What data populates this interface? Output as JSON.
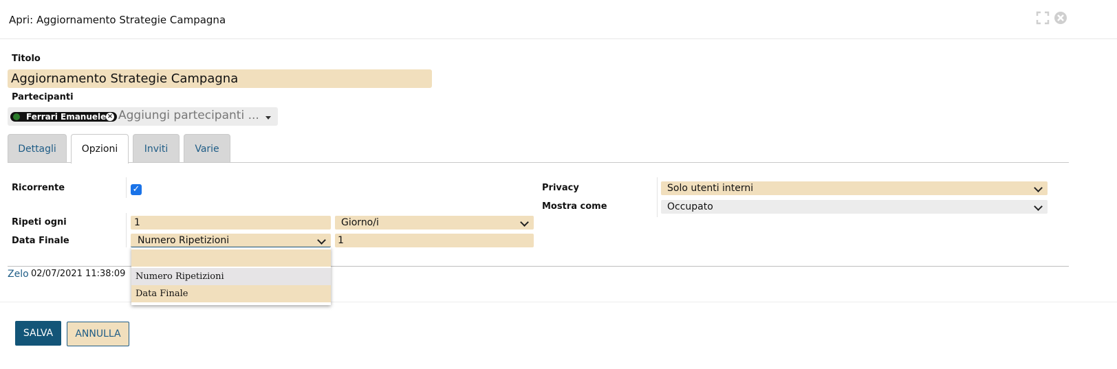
{
  "window": {
    "title": "Apri: Aggiornamento Strategie Campagna",
    "icons": [
      "expand-icon",
      "close-icon"
    ]
  },
  "form": {
    "titolo_label": "Titolo",
    "titolo_value": "Aggiornamento Strategie Campagna",
    "partecipanti_label": "Partecipanti",
    "participant_chip": "Ferrari Emanuele",
    "partecipanti_placeholder": "Aggiungi partecipanti ..."
  },
  "tabs": [
    {
      "label": "Dettagli",
      "active": false
    },
    {
      "label": "Opzioni",
      "active": true
    },
    {
      "label": "Inviti",
      "active": false
    },
    {
      "label": "Varie",
      "active": false
    }
  ],
  "options": {
    "ricorrente_label": "Ricorrente",
    "ricorrente_checked": true,
    "ripeti_ogni_label": "Ripeti ogni",
    "ripeti_ogni_value": "1",
    "ripeti_unit": "Giorno/i",
    "data_finale_label": "Data Finale",
    "data_finale_mode": "Numero Ripetizioni",
    "data_finale_value": "1",
    "dropdown_options": [
      "",
      "Numero Ripetizioni",
      "Data Finale"
    ],
    "privacy_label": "Privacy",
    "privacy_value": "Solo utenti interni",
    "mostra_come_label": "Mostra come",
    "mostra_come_value": "Occupato"
  },
  "footer": {
    "author": "Zelo",
    "timestamp": "02/07/2021 11:38:09"
  },
  "buttons": {
    "save": "SALVA",
    "cancel": "ANNULLA"
  },
  "colors": {
    "accent": "#135578",
    "field_bg": "#f1dfbd",
    "link": "#1e5c86",
    "checkbox": "#1a73e8"
  }
}
